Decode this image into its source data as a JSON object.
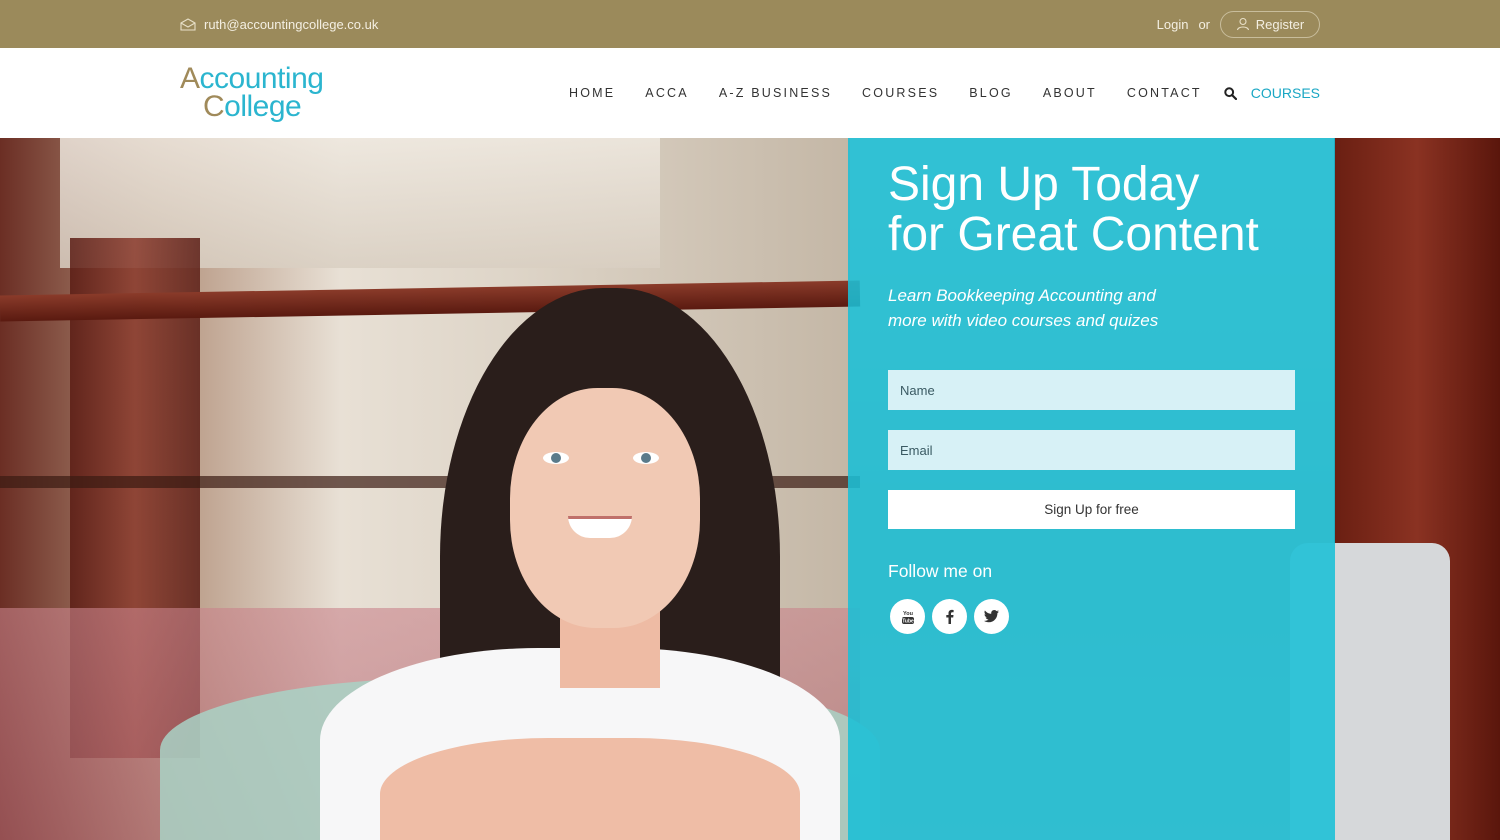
{
  "topbar": {
    "email": "ruth@accountingcollege.co.uk",
    "login": "Login",
    "or": "or",
    "register": "Register"
  },
  "logo": {
    "line1": "Accounting",
    "line2": "College"
  },
  "nav": {
    "items": [
      "HOME",
      "ACCA",
      "A-Z BUSINESS",
      "COURSES",
      "BLOG",
      "ABOUT",
      "CONTACT"
    ],
    "courses_link": "COURSES"
  },
  "signup": {
    "title_line1": "Sign Up Today",
    "title_line2": "for Great Content",
    "subtitle_line1": "Learn Bookkeeping Accounting and",
    "subtitle_line2": "more with video courses and quizes",
    "name_placeholder": "Name",
    "email_placeholder": "Email",
    "button": "Sign Up for free",
    "follow": "Follow me on"
  },
  "socials": [
    "youtube-icon",
    "facebook-icon",
    "twitter-icon"
  ],
  "colors": {
    "topbar": "#9b8a5b",
    "accent": "#1aa7c4",
    "panel": "#1abfd6"
  }
}
